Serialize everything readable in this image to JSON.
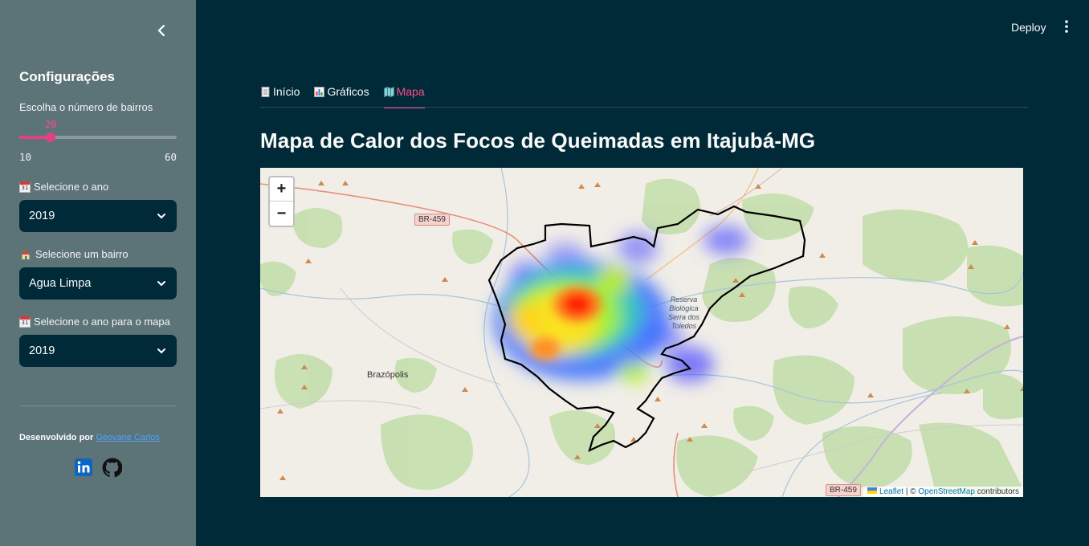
{
  "sidebar": {
    "title": "Configurações",
    "slider": {
      "label": "Escolha o número de bairros",
      "value": "20",
      "min": "10",
      "max": "60",
      "fraction": 0.2
    },
    "year_select": {
      "label": "Selecione o ano",
      "value": "2019"
    },
    "bairro_select": {
      "label": "Selecione um bairro",
      "value": "Agua Limpa"
    },
    "map_year_select": {
      "label": "Selecione o ano para o mapa",
      "value": "2019"
    },
    "credit_prefix": "Desenvolvido por",
    "credit_link": "Geovane Carlos",
    "icons": [
      "chevron-left-icon",
      "calendar-icon",
      "house-icon",
      "linkedin-icon",
      "github-icon"
    ]
  },
  "header": {
    "deploy_label": "Deploy"
  },
  "tabs": [
    {
      "label": "Início",
      "icon": "page-icon"
    },
    {
      "label": "Gráficos",
      "icon": "bar-chart-icon"
    },
    {
      "label": "Mapa",
      "icon": "map-icon",
      "active": true
    }
  ],
  "main": {
    "title": "Mapa de Calor dos Focos de Queimadas em Itajubá-MG"
  },
  "map": {
    "zoom_in": "+",
    "zoom_out": "−",
    "road_label_1": "BR-459",
    "road_label_2": "BR-459",
    "place_brazopolis": "Brazópolis",
    "reserve_label_1": "Reserva",
    "reserve_label_2": "Biológica",
    "reserve_label_3": "Serra dos",
    "reserve_label_4": "Toledos",
    "attribution_leaflet": "Leaflet",
    "attribution_sep": " | © ",
    "attribution_osm": "OpenStreetMap",
    "attribution_suffix": " contributors"
  },
  "colors": {
    "accent": "#ff4b8c",
    "sidebar_bg": "#5c7378",
    "main_bg": "#002a37",
    "link": "#4ba3ff"
  }
}
